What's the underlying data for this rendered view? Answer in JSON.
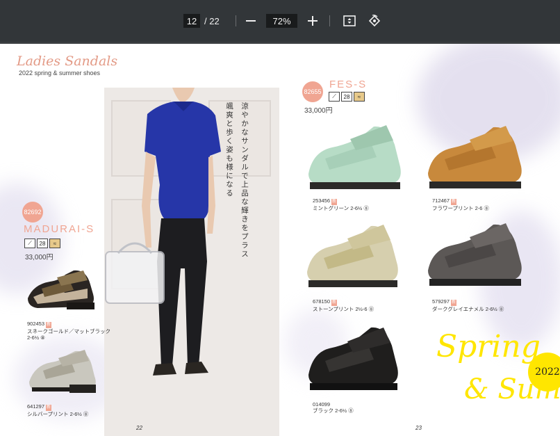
{
  "toolbar": {
    "current_page": "12",
    "page_total": "/ 22",
    "zoom": "72%",
    "zoom_out_icon": "minus-icon",
    "zoom_in_icon": "plus-icon",
    "fit_icon": "fit-page-icon",
    "rotate_icon": "rotate-icon"
  },
  "catalog": {
    "title": "Ladies Sandals",
    "subtitle": "2022 spring & summer shoes",
    "vertical_copy_1": "涼やかなサンダルで上品な輝きをプラス",
    "vertical_copy_2": "颯爽と歩く姿も様になる",
    "left_page_number": "22",
    "right_page_number": "23",
    "spring_text": "Spring",
    "summer_text": "& Sumr",
    "year_badge": "2022"
  },
  "madurai": {
    "code": "82692",
    "name": "MADURAI-S",
    "icon_a": "⟋",
    "icon_b": "28",
    "icon_c": "≈",
    "price": "33,000円",
    "variants": [
      {
        "id": "902453",
        "tag": "新",
        "desc": "スネークゴールド／マットブラック",
        "size": "2-6½ ⑧"
      },
      {
        "id": "641297",
        "tag": "新",
        "desc": "シルバープリント 2-6½ ⑧",
        "size": ""
      }
    ]
  },
  "fes": {
    "code": "82655",
    "name": "FES-S",
    "icon_a": "⟋",
    "icon_b": "28",
    "icon_c": "≈",
    "price": "33,000円",
    "variants": [
      {
        "id": "253456",
        "tag": "新",
        "desc": "ミントグリーン 2-6½ ⑧"
      },
      {
        "id": "712467",
        "tag": "新",
        "desc": "フラワープリント 2-6 ⑧"
      },
      {
        "id": "678150",
        "tag": "新",
        "desc": "ストーンプリント 2½-6 ⑧"
      },
      {
        "id": "579297",
        "tag": "新",
        "desc": "ダークグレイエナメル 2-6½ ⑧"
      },
      {
        "id": "014099",
        "tag": "",
        "desc": "ブラック 2-6½ ⑧"
      }
    ]
  },
  "colors": {
    "accent": "#f0a592",
    "toolbar_bg": "#323639",
    "spring_yellow": "#ffe600",
    "wash_purple": "#c9c3de"
  }
}
